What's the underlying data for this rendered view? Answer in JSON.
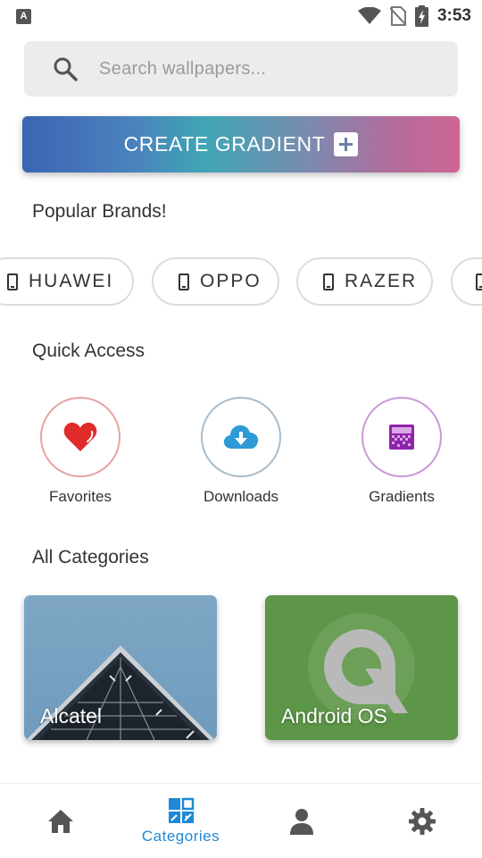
{
  "status_bar": {
    "app_icon_letter": "A",
    "time": "3:53",
    "icons": [
      "wifi-icon",
      "no-sim-icon",
      "battery-charging-icon"
    ]
  },
  "search": {
    "placeholder": "Search wallpapers...",
    "value": "",
    "icon": "search-icon"
  },
  "create_gradient": {
    "label": "CREATE GRADIENT",
    "icon": "plus-box-icon",
    "gradient_colors": [
      "#3c64b4",
      "#40a6b4",
      "#cf6693"
    ]
  },
  "popular_brands": {
    "title": "Popular Brands!",
    "items": [
      {
        "label": "HUAWEI",
        "icon": "phone-icon"
      },
      {
        "label": "OPPO",
        "icon": "phone-icon"
      },
      {
        "label": "RAZER",
        "icon": "phone-icon"
      },
      {
        "label": "",
        "icon": "phone-icon"
      }
    ]
  },
  "quick_access": {
    "title": "Quick Access",
    "items": [
      {
        "label": "Favorites",
        "icon": "heart-icon",
        "color": "#e02b2b"
      },
      {
        "label": "Downloads",
        "icon": "cloud-download-icon",
        "color": "#2e9ad6"
      },
      {
        "label": "Gradients",
        "icon": "gradient-icon",
        "color": "#8e24aa"
      }
    ]
  },
  "all_categories": {
    "title": "All Categories",
    "items": [
      {
        "label": "Alcatel"
      },
      {
        "label": "Android OS"
      }
    ]
  },
  "bottom_nav": {
    "items": [
      {
        "label": "",
        "icon": "home-icon"
      },
      {
        "label": "Categories",
        "icon": "categories-icon",
        "active": true
      },
      {
        "label": "",
        "icon": "profile-icon"
      },
      {
        "label": "",
        "icon": "settings-gear-icon"
      }
    ],
    "active_color": "#1e8ad6",
    "inactive_color": "#555555"
  }
}
